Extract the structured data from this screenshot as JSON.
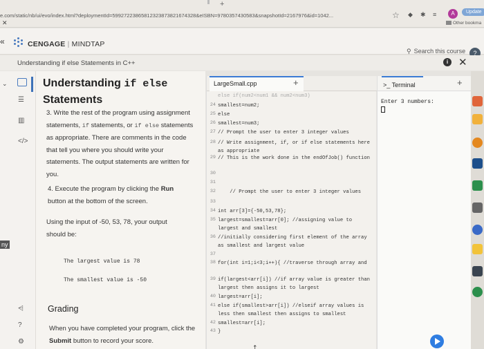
{
  "browser": {
    "url": "e.com/static/nb/ui/evo/index.html?deploymentId=59927223865812323873821674328&eISBN=9780357430583&snapshotId=2167976&id=1042...",
    "update_label": "Update",
    "other_bookmarks": "Other bookma",
    "avatar_letter": "A"
  },
  "header": {
    "brand_left": "CENGAGE",
    "brand_right": "MINDTAP",
    "search_label": "Search this course"
  },
  "breadcrumb": "Understanding if else Statements in C++",
  "rail": {
    "edge_text": "ny",
    "icons": [
      "book-icon",
      "list-icon",
      "chart-icon",
      "code-icon",
      "share-icon",
      "help-icon",
      "settings-icon"
    ]
  },
  "instructions": {
    "title_plain": "Understanding ",
    "title_code": "if else",
    "title_tail": "Statements",
    "step3_pre": "3. Write the rest of the program using assignment statements, ",
    "step3_code1": "if",
    "step3_mid": " statements, or ",
    "step3_code2": "if else",
    "step3_post": " statements as appropriate. There are comments in the code that tell you where you should write your statements. The output statements are written for you.",
    "step4_pre": "4. Execute the program by clicking the ",
    "step4_bold": "Run",
    "step4_post": " button at the bottom of the screen.",
    "input_note": "Using the input of -50, 53, 78, your output should be:",
    "output_largest": "The largest value is 78",
    "output_smallest": "The smallest value is -50",
    "grading_heading": "Grading",
    "grading_pre": "When you have completed your program, click the ",
    "grading_bold": "Submit",
    "grading_post": " button to record your score."
  },
  "editor": {
    "tab_label": "LargeSmall.cpp",
    "lines": [
      {
        "n": "",
        "t": "else if(num2<num1 && num2<num3)",
        "ghost": true
      },
      {
        "n": "24",
        "t": "smallest=num2;"
      },
      {
        "n": "25",
        "t": "else"
      },
      {
        "n": "26",
        "t": "smallest=num3;"
      },
      {
        "n": "27",
        "t": "// Prompt the user to enter 3 integer values"
      },
      {
        "n": "28",
        "t": "// Write assignment, if, or if else statements here as appropriate"
      },
      {
        "n": "29",
        "t": "// This is the work done in the endOfJob() function"
      },
      {
        "n": "30",
        "t": ""
      },
      {
        "n": "31",
        "t": ""
      },
      {
        "n": "32",
        "t": "    // Prompt the user to enter 3 integer values"
      },
      {
        "n": "33",
        "t": ""
      },
      {
        "n": "34",
        "t": "int arr[3]={-50,53,78};"
      },
      {
        "n": "35",
        "t": "largest=smallest=arr[0]; //assigning value to largest and smallest"
      },
      {
        "n": "36",
        "t": "//initially considering first element of the array as smallest and largest value"
      },
      {
        "n": "37",
        "t": ""
      },
      {
        "n": "38",
        "t": "for(int i=1;i<3;i++){ //traverse through array and"
      },
      {
        "n": "39",
        "t": "if(largest<arr[i]) //if array value is greater than largest then assigns it to largest"
      },
      {
        "n": "40",
        "t": "largest=arr[i];"
      },
      {
        "n": "41",
        "t": "else if(smallest>arr[i]) //elseif array values is less then smallest then assigns to smallest"
      },
      {
        "n": "42",
        "t": "smallest=arr[i];"
      },
      {
        "n": "43",
        "t": "}"
      }
    ]
  },
  "terminal": {
    "tab_label": "Terminal",
    "output": "Enter 3 numbers:"
  }
}
